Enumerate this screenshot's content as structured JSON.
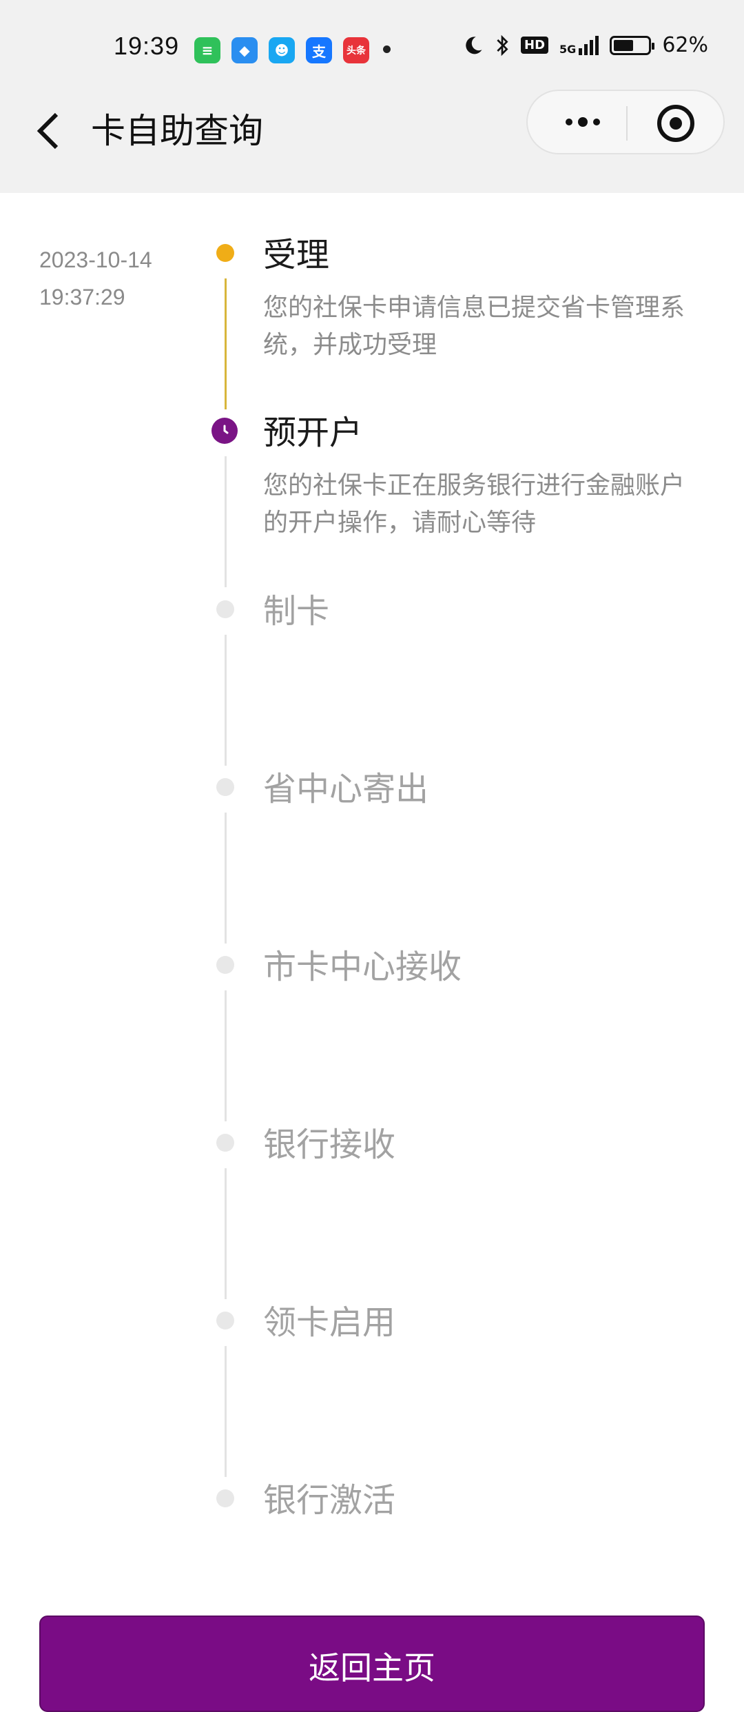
{
  "status_bar": {
    "time": "19:39",
    "app_icons": [
      {
        "name": "messages-icon",
        "glyph": "≡",
        "color": "#2fc15a"
      },
      {
        "name": "browser-icon",
        "glyph": "◆",
        "color": "#2a8ef0"
      },
      {
        "name": "qq-icon",
        "glyph": "☻",
        "color": "#19a7f2"
      },
      {
        "name": "alipay-icon",
        "glyph": "支",
        "color": "#1677ff"
      },
      {
        "name": "toutiao-icon",
        "glyph": "头条",
        "color": "#e8333a"
      }
    ],
    "hd_label": "HD",
    "network_label": "5G",
    "battery_text": "62%",
    "battery_level": 0.62
  },
  "nav": {
    "title": "卡自助查询"
  },
  "timeline": {
    "steps": [
      {
        "title": "受理",
        "date": "2023-10-14",
        "time": "19:37:29",
        "description": "您的社保卡申请信息已提交省卡管理系统，并成功受理",
        "state": "done"
      },
      {
        "title": "预开户",
        "description": "您的社保卡正在服务银行进行金融账户的开户操作，请耐心等待",
        "state": "current"
      },
      {
        "title": "制卡",
        "state": "pending"
      },
      {
        "title": "省中心寄出",
        "state": "pending"
      },
      {
        "title": "市卡中心接收",
        "state": "pending"
      },
      {
        "title": "银行接收",
        "state": "pending"
      },
      {
        "title": "领卡启用",
        "state": "pending"
      },
      {
        "title": "银行激活",
        "state": "pending"
      }
    ]
  },
  "footer": {
    "button_label": "返回主页"
  },
  "colors": {
    "accent": "#7a0c85",
    "done": "#f0ad17"
  }
}
